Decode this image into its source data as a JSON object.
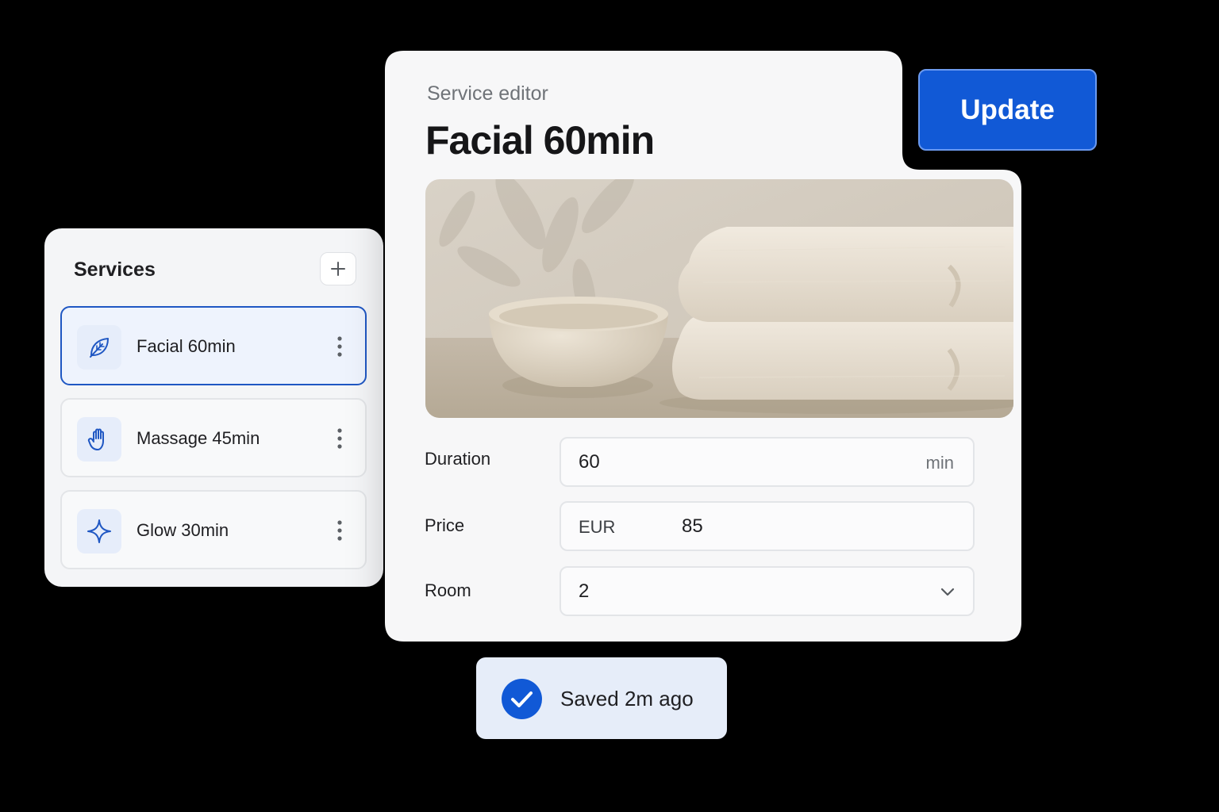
{
  "services": {
    "title": "Services",
    "add_button_icon": "plus-icon",
    "items": [
      {
        "label": "Facial 60min",
        "icon": "leaf-icon",
        "selected": true
      },
      {
        "label": "Massage 45min",
        "icon": "hand-icon",
        "selected": false
      },
      {
        "label": "Glow 30min",
        "icon": "sparkle-icon",
        "selected": false
      }
    ]
  },
  "editor": {
    "subtitle": "Service editor",
    "title": "Facial 60min",
    "image": "bowl-and-towels-photo",
    "fields": {
      "duration": {
        "label": "Duration",
        "value": "60",
        "unit": "min"
      },
      "price": {
        "label": "Price",
        "currency": "EUR",
        "value": "85"
      },
      "room": {
        "label": "Room",
        "value": "2"
      }
    }
  },
  "update_button": {
    "label": "Update"
  },
  "toast": {
    "text": "Saved 2m ago",
    "icon": "check-circle-icon"
  },
  "colors": {
    "accent": "#1159d6",
    "selected_border": "#1f57c3",
    "toast_bg": "#e6edf9",
    "background": "#000000"
  }
}
